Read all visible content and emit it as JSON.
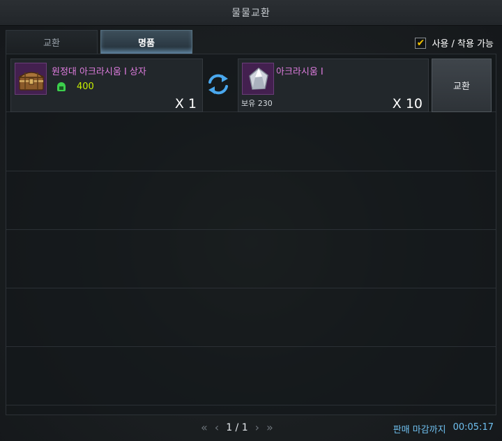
{
  "window": {
    "title": "물물교환"
  },
  "tabs": [
    {
      "label": "교환"
    },
    {
      "label": "명품"
    }
  ],
  "filter": {
    "checked": true,
    "label": "사용 / 착용 가능"
  },
  "listing": {
    "give": {
      "name": "원정대 아크라시움 I 상자",
      "cost": "400",
      "quantity": "X 1",
      "icon": "treasure-chest-icon",
      "cost_icon": "helmet-icon"
    },
    "exchange_icon": "swap-arrows-icon",
    "receive": {
      "name": "아크라시움 I",
      "owned": "보유 230",
      "quantity": "X 10",
      "icon": "crystal-icon"
    },
    "exchange_label": "교환"
  },
  "pagination": {
    "first": "«",
    "prev": "‹",
    "page": "1 / 1",
    "next": "›",
    "last": "»"
  },
  "deadline": {
    "label": "판매 마감까지",
    "time": "00:05:17"
  },
  "colors": {
    "item_name": "#e07de0",
    "cost": "#c8f000",
    "deadline": "#6fc0f0",
    "checkbox": "#f2c200"
  }
}
